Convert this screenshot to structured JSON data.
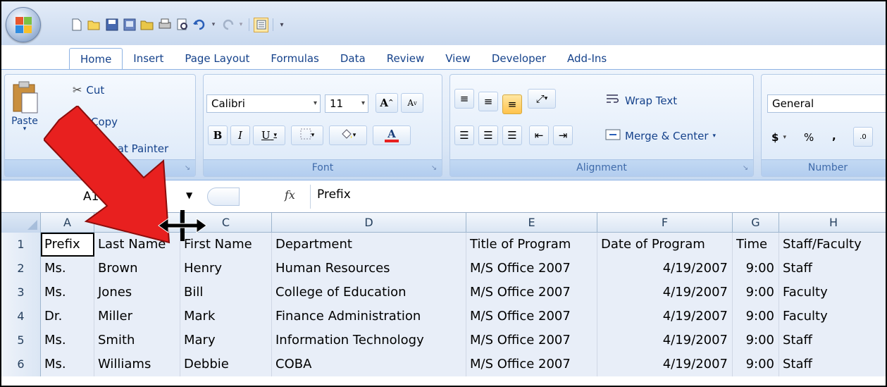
{
  "qat": {
    "icons": [
      "new-icon",
      "open-icon",
      "save-icon",
      "print-preview-icon",
      "folder-icon",
      "print-icon",
      "preview-icon",
      "undo-icon",
      "redo-icon",
      "form-icon"
    ]
  },
  "tabs": [
    "Home",
    "Insert",
    "Page Layout",
    "Formulas",
    "Data",
    "Review",
    "View",
    "Developer",
    "Add-Ins"
  ],
  "ribbon": {
    "clipboard": {
      "paste": "Paste",
      "cut": "Cut",
      "copy": "Copy",
      "format_painter": "Format Painter",
      "label": "Clipboard"
    },
    "font": {
      "name": "Calibri",
      "size": "11",
      "label": "Font",
      "bold": "B",
      "italic": "I",
      "underline": "U"
    },
    "alignment": {
      "wrap": "Wrap Text",
      "merge": "Merge & Center",
      "label": "Alignment"
    },
    "number": {
      "format": "General",
      "currency": "$",
      "percent": "%",
      "comma": ",",
      "label": "Number"
    }
  },
  "formula_bar": {
    "name_box": "A1",
    "fx": "fx",
    "value": "Prefix"
  },
  "columns": [
    "A",
    "B",
    "C",
    "D",
    "E",
    "F",
    "G",
    "H"
  ],
  "rows": [
    {
      "n": "1",
      "cells": [
        "Prefix",
        "Last Name",
        "First Name",
        "Department",
        "Title of Program",
        "Date of Program",
        "Time",
        "Staff/Faculty"
      ]
    },
    {
      "n": "2",
      "cells": [
        "Ms.",
        "Brown",
        "Henry",
        "Human Resources",
        "M/S Office 2007",
        "4/19/2007",
        "9:00",
        "Staff"
      ]
    },
    {
      "n": "3",
      "cells": [
        "Ms.",
        "Jones",
        "Bill",
        "College of Education",
        "M/S Office 2007",
        "4/19/2007",
        "9:00",
        "Faculty"
      ]
    },
    {
      "n": "4",
      "cells": [
        "Dr.",
        "Miller",
        "Mark",
        "Finance Administration",
        "M/S Office 2007",
        "4/19/2007",
        "9:00",
        "Faculty"
      ]
    },
    {
      "n": "5",
      "cells": [
        "Ms.",
        "Smith",
        "Mary",
        "Information Technology",
        "M/S Office 2007",
        "4/19/2007",
        "9:00",
        "Staff"
      ]
    },
    {
      "n": "6",
      "cells": [
        "Ms.",
        "Williams",
        "Debbie",
        "COBA",
        "M/S Office 2007",
        "4/19/2007",
        "9:00",
        "Staff"
      ]
    }
  ],
  "colors": {
    "accent": "#15428b",
    "arrow": "#e8201f",
    "ribbon_border": "#8db2e3"
  }
}
